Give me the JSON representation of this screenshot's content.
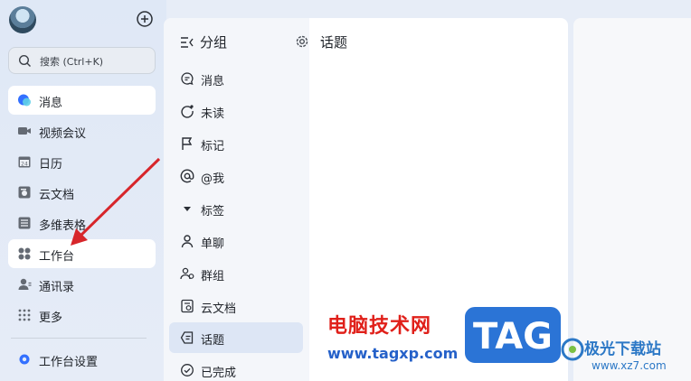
{
  "sidebar": {
    "search_placeholder": "搜索 (Ctrl+K)",
    "items": [
      {
        "label": "消息",
        "icon": "chat-bubble-icon",
        "active": true
      },
      {
        "label": "视频会议",
        "icon": "video-camera-icon"
      },
      {
        "label": "日历",
        "icon": "calendar-icon",
        "badge": "24"
      },
      {
        "label": "云文档",
        "icon": "cloud-doc-icon"
      },
      {
        "label": "多维表格",
        "icon": "table-icon"
      },
      {
        "label": "工作台",
        "icon": "workbench-icon",
        "highlighted": true
      },
      {
        "label": "通讯录",
        "icon": "contacts-icon"
      },
      {
        "label": "更多",
        "icon": "grid-dots-icon"
      }
    ],
    "settings_label": "工作台设置"
  },
  "panel": {
    "title": "分组",
    "items": [
      {
        "label": "消息",
        "icon": "message-icon"
      },
      {
        "label": "未读",
        "icon": "unread-icon"
      },
      {
        "label": "标记",
        "icon": "flag-icon"
      },
      {
        "label": "@我",
        "icon": "at-icon"
      },
      {
        "label": "标签",
        "icon": "caret-down-icon"
      },
      {
        "label": "单聊",
        "icon": "person-icon"
      },
      {
        "label": "群组",
        "icon": "group-icon"
      },
      {
        "label": "云文档",
        "icon": "doc-icon"
      },
      {
        "label": "话题",
        "icon": "topic-icon",
        "active": true
      },
      {
        "label": "已完成",
        "icon": "done-check-icon"
      }
    ]
  },
  "content": {
    "title": "话题"
  },
  "watermark": {
    "site_name": "电脑技术网",
    "site_url": "www.tagxp.com",
    "tag_text": "TAG",
    "brand_name": "极光下载站",
    "brand_url": "www.xz7.com"
  },
  "colors": {
    "accent": "#3370ff",
    "active_panel": "#dde6f5",
    "arrow": "#d7262b",
    "tag_bg": "#2b74d6"
  }
}
